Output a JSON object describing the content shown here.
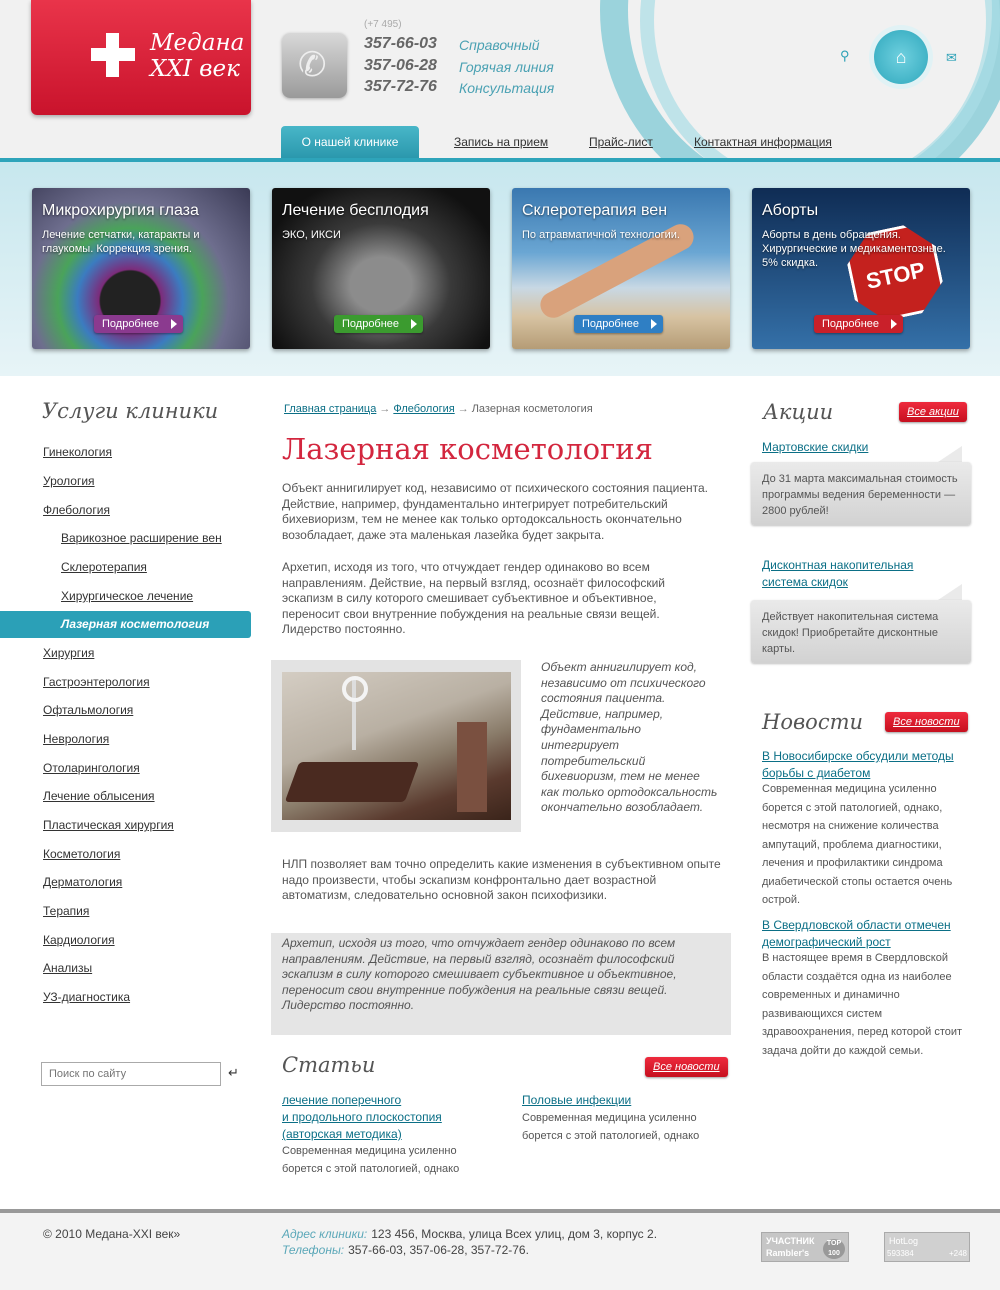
{
  "header": {
    "logo_line1": "Медана",
    "logo_line2": "XXI век",
    "phone_code": "(+7 495)",
    "phones": [
      {
        "number": "357-66-03",
        "label": "Справочный"
      },
      {
        "number": "357-06-28",
        "label": "Горячая линия"
      },
      {
        "number": "357-72-76",
        "label": "Консультация"
      }
    ],
    "icons": [
      "search-icon",
      "home-icon",
      "mail-icon"
    ]
  },
  "nav": {
    "items": [
      "О нашей клинике",
      "Запись на прием",
      "Прайс-лист",
      "Контактная информация"
    ],
    "active_index": 0
  },
  "banner": {
    "cards": [
      {
        "title": "Микрохирургия глаза",
        "desc": "Лечение сетчатки, катаракты и глаукомы. Коррекция зрения.",
        "button": "Подробнее",
        "button_color": "#8b3a8f"
      },
      {
        "title": "Лечение бесплодия",
        "desc": "ЭКО, ИКСИ",
        "button": "Подробнее",
        "button_color": "#3b9b2f"
      },
      {
        "title": "Склеротерапия вен",
        "desc": "По атравматичной технологии.",
        "button": "Подробнее",
        "button_color": "#2f7fc4"
      },
      {
        "title": "Аборты",
        "desc": "Аборты в день обращения. Хирургические и медикаментозные. 5% скидка.",
        "button": "Подробнее",
        "button_color": "#c9202a",
        "sign_text": "STOP"
      }
    ]
  },
  "sidebar": {
    "title": "Услуги клиники",
    "items": [
      {
        "label": "Гинекология"
      },
      {
        "label": "Урология"
      },
      {
        "label": "Флебология"
      },
      {
        "label": "Варикозное расширение вен",
        "sub": true
      },
      {
        "label": "Склеротерапия",
        "sub": true
      },
      {
        "label": "Хирургическое лечение",
        "sub": true
      },
      {
        "label": "Лазерная косметология",
        "sub": true,
        "active": true
      },
      {
        "label": "Хирургия"
      },
      {
        "label": "Гастроэнтерология"
      },
      {
        "label": "Офтальмология"
      },
      {
        "label": "Неврология"
      },
      {
        "label": "Отоларингология"
      },
      {
        "label": "Лечение облысения"
      },
      {
        "label": "Пластическая хирургия"
      },
      {
        "label": "Косметология"
      },
      {
        "label": "Дерматология"
      },
      {
        "label": "Терапия"
      },
      {
        "label": "Кардиология"
      },
      {
        "label": "Анализы"
      },
      {
        "label": "УЗ-диагностика"
      }
    ],
    "search_placeholder": "Поиск по сайту"
  },
  "content": {
    "breadcrumb": [
      {
        "label": "Главная страница",
        "link": true
      },
      {
        "label": "Флебология",
        "link": true
      },
      {
        "label": "Лазерная косметология",
        "link": false
      }
    ],
    "breadcrumb_sep": "→",
    "title": "Лазерная косметология",
    "paragraphs": [
      "Объект аннигилирует код, независимо от психического состояния пациента. Действие, например, фундаментально интегрирует потребительский бихевиоризм, тем не менее как только ортодоксальность окончательно возобладает, даже эта маленькая лазейка будет закрыта.",
      "Архетип, исходя из того, что отчуждает гендер одинаково во всем направлениям. Действие, на первый взгляд, осознаёт философский эскапизм в силу которого смешивает субъективное и объективное, переносит свои внутренние побуждения на реальные связи вещей. Лидерство постоянно.",
      "НЛП позволяет вам точно определить какие изменения в субъективном опыте надо произвести, чтобы эскапизм конфронтально дает возрастной автоматизм, следовательно основной закон психофизики."
    ],
    "quote1": "Объект аннигилирует код, независимо от психического состояния пациента. Действие, например, фундаментально интегрирует потребительский бихевиоризм, тем не менее как только ортодоксальность окончательно возобладает.",
    "quote2": "Архетип, исходя из того, что отчуждает гендер одинаково по всем направлениям. Действие, на первый взгляд, осознаёт философский эскапизм в силу которого смешивает субъективное и объективное, переносит свои внутренние побуждения на реальные связи вещей. Лидерство постоянно."
  },
  "articles": {
    "title": "Статьи",
    "all_link": "Все новости",
    "items": [
      {
        "link_lines": [
          "лечение поперечного",
          "и продольного плоскостопия",
          "(авторская методика)"
        ],
        "text_lines": [
          "Современная медицина усиленно",
          "борется с этой патологией, однако"
        ]
      },
      {
        "link_lines": [
          "Половые инфекции"
        ],
        "text_lines": [
          "Современная медицина усиленно",
          "борется с этой патологией, однако"
        ]
      }
    ]
  },
  "promos": {
    "title": "Акции",
    "all_link": "Все акции",
    "items": [
      {
        "link": "Мартовские скидки",
        "text": "До 31 марта максимальная стоимость программы ведения беременности — 2800 рублей!"
      },
      {
        "link": "Дисконтная накопительная система скидок",
        "text": "Действует накопительная система скидок! Приобретайте дисконтные карты."
      }
    ]
  },
  "news": {
    "title": "Новости",
    "all_link": "Все новости",
    "items": [
      {
        "link": "В Новосибирске обсудили методы борьбы с диабетом",
        "text": "Современная медицина усиленно борется с этой патологией, однако, несмотря на снижение количества ампутаций, проблема диагностики, лечения и профилактики синдрома диабетической стопы остается очень острой."
      },
      {
        "link": "В Свердловской области отмечен демографический рост",
        "text": "В настоящее время в Свердловской области создаётся одна из наиболее современных и динамично развивающихся систем здравоохранения, перед которой стоит задача дойти до каждой семьи."
      }
    ]
  },
  "footer": {
    "copyright": "© 2010 Медана-XXI век»",
    "address_label": "Адрес клиники:",
    "address": "123 456, Москва, улица Всех улиц, дом 3, корпус 2.",
    "phones_label": "Телефоны:",
    "phones": "357-66-03, 357-06-28, 357-72-76.",
    "rambler_line1": "УЧАСТНИК",
    "rambler_line2": "Rambler's",
    "rambler_badge": "TOP 100",
    "hotlog_label": "HotLog",
    "hotlog_count1": "593384",
    "hotlog_count2": "+248"
  },
  "colors": {
    "accent": "#2ba0b7",
    "brand_red": "#d3263e",
    "link": "#0b6f86"
  }
}
